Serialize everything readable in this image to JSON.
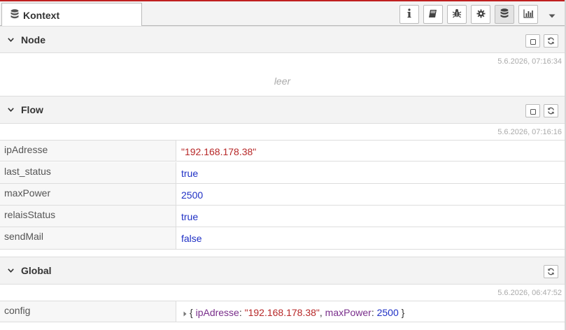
{
  "tab": {
    "title": "Kontext",
    "icon": "database-icon"
  },
  "toolbar": {
    "buttons": [
      {
        "name": "info",
        "icon": "info-icon"
      },
      {
        "name": "help",
        "icon": "book-icon"
      },
      {
        "name": "debug",
        "icon": "bug-icon"
      },
      {
        "name": "config",
        "icon": "gear-icon"
      },
      {
        "name": "context",
        "icon": "database-icon",
        "selected": true
      },
      {
        "name": "dashboard",
        "icon": "bar-chart-icon"
      },
      {
        "name": "more",
        "icon": "caret-down-icon"
      }
    ]
  },
  "sections": {
    "node": {
      "title": "Node",
      "timestamp": "5.6.2026, 07:16:34",
      "empty_text": "leer"
    },
    "flow": {
      "title": "Flow",
      "timestamp": "5.6.2026, 07:16:16",
      "rows": [
        {
          "key": "ipAdresse",
          "value": "\"192.168.178.38\""
        },
        {
          "key": "last_status",
          "value": "true"
        },
        {
          "key": "maxPower",
          "value": "2500"
        },
        {
          "key": "relaisStatus",
          "value": "true"
        },
        {
          "key": "sendMail",
          "value": "false"
        }
      ]
    },
    "global": {
      "title": "Global",
      "timestamp": "5.6.2026, 06:47:52",
      "rows": [
        {
          "key": "config",
          "value": {
            "open": "{",
            "k1": "ipAdresse",
            "v1": "\"192.168.178.38\"",
            "k2": "maxPower",
            "v2": "2500",
            "close": "}"
          }
        }
      ]
    }
  }
}
